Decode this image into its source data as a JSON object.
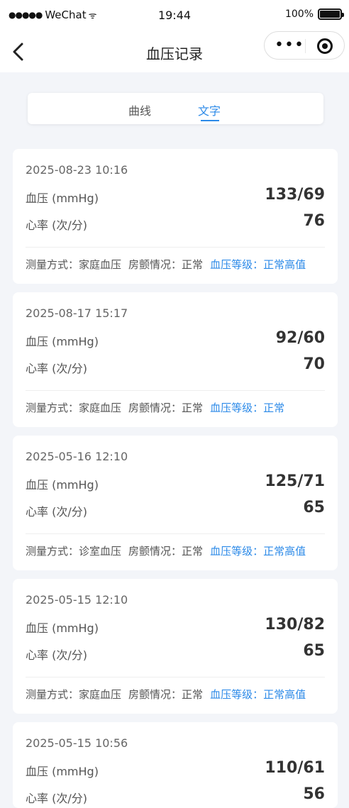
{
  "status_bar": {
    "signal": "●●●●●",
    "carrier": "WeChat",
    "wifi": "ᯤ",
    "time": "19:44",
    "battery": "100%"
  },
  "nav": {
    "title": "血压记录",
    "more": "•••"
  },
  "tabs": {
    "curve": "曲线",
    "text": "文字",
    "active": "文字"
  },
  "labels": {
    "bp": "血压 (mmHg)",
    "hr": "心率 (次/分)",
    "method_prefix": "测量方式：",
    "af_prefix": "房颤情况：",
    "level_prefix": "血压等级："
  },
  "records": [
    {
      "datetime": "2025-08-23 10:16",
      "bp": "133/69",
      "hr": "76",
      "method": "家庭血压",
      "af": "正常",
      "level": "正常高值"
    },
    {
      "datetime": "2025-08-17 15:17",
      "bp": "92/60",
      "hr": "70",
      "method": "家庭血压",
      "af": "正常",
      "level": "正常"
    },
    {
      "datetime": "2025-05-16 12:10",
      "bp": "125/71",
      "hr": "65",
      "method": "诊室血压",
      "af": "正常",
      "level": "正常高值"
    },
    {
      "datetime": "2025-05-15 12:10",
      "bp": "130/82",
      "hr": "65",
      "method": "家庭血压",
      "af": "正常",
      "level": "正常高值"
    },
    {
      "datetime": "2025-05-15 10:56",
      "bp": "110/61",
      "hr": "56",
      "method": "",
      "af": "",
      "level": ""
    }
  ],
  "colors": {
    "accent": "#2c8ae8",
    "page_bg": "#f3f5f9",
    "card_bg": "#ffffff"
  }
}
